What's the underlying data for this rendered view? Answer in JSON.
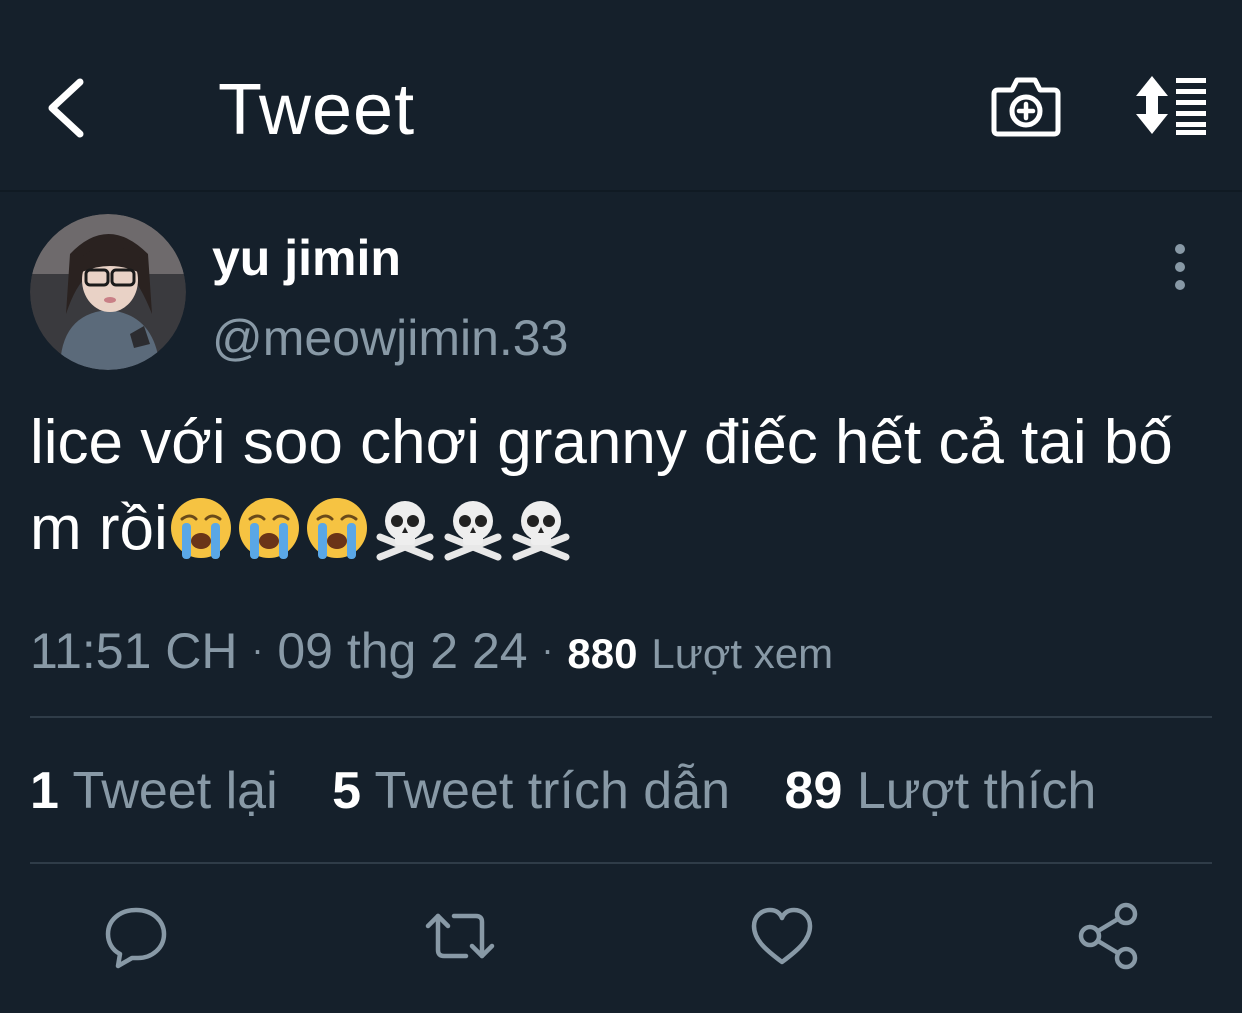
{
  "header": {
    "title": "Tweet",
    "back_icon": "chevron-left-icon",
    "camera_icon": "camera-plus-icon",
    "sort_icon": "sort-thread-icon"
  },
  "author": {
    "name": "yu jimin",
    "handle": "@meowjimin.33"
  },
  "tweet": {
    "text": "lice với soo chơi granny điếc hết cả tai bố m rồi",
    "emoji": [
      "loudly-crying-face",
      "loudly-crying-face",
      "loudly-crying-face",
      "skull-and-crossbones",
      "skull-and-crossbones",
      "skull-and-crossbones"
    ],
    "time": "11:51 CH",
    "sep": "·",
    "date": "09 thg 2 24",
    "views_count": "880",
    "views_label": "Lượt xem"
  },
  "stats": {
    "retweets_count": "1",
    "retweets_label": "Tweet lại",
    "quotes_count": "5",
    "quotes_label": "Tweet trích dẫn",
    "likes_count": "89",
    "likes_label": "Lượt thích"
  },
  "actions": [
    "reply-icon",
    "retweet-icon",
    "like-icon",
    "share-icon"
  ],
  "colors": {
    "background": "#15202b",
    "text_primary": "#ffffff",
    "text_secondary": "#8899a6",
    "divider": "#2f3c48"
  }
}
